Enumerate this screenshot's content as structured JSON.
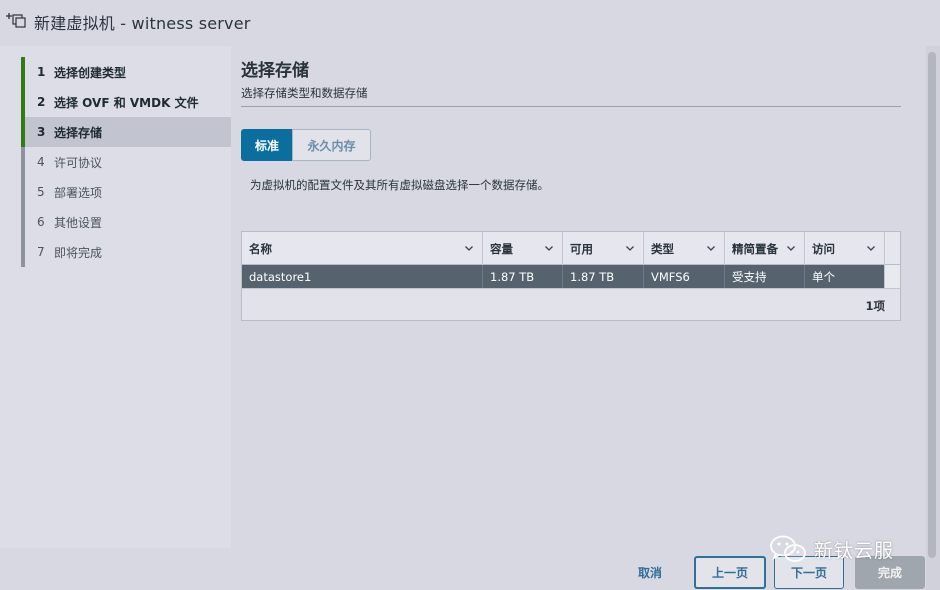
{
  "window": {
    "title": "新建虚拟机 - witness server",
    "icon": "new-vm-icon"
  },
  "sidebar": {
    "steps": [
      {
        "num": "1",
        "label": "选择创建类型",
        "state": "done"
      },
      {
        "num": "2",
        "label": "选择 OVF 和 VMDK 文件",
        "state": "done"
      },
      {
        "num": "3",
        "label": "选择存储",
        "state": "current"
      },
      {
        "num": "4",
        "label": "许可协议",
        "state": "pending"
      },
      {
        "num": "5",
        "label": "部署选项",
        "state": "pending"
      },
      {
        "num": "6",
        "label": "其他设置",
        "state": "pending"
      },
      {
        "num": "7",
        "label": "即将完成",
        "state": "pending"
      }
    ],
    "done_color": "#2e7d14",
    "pending_color": "#8f939b"
  },
  "main": {
    "title": "选择存储",
    "subtitle": "选择存储类型和数据存储",
    "tabs": [
      {
        "label": "标准",
        "active": true
      },
      {
        "label": "永久内存",
        "active": false
      }
    ],
    "description": "为虚拟机的配置文件及其所有虚拟磁盘选择一个数据存储。"
  },
  "grid": {
    "columns": [
      "名称",
      "容量",
      "可用",
      "类型",
      "精简置备",
      "访问"
    ],
    "rows": [
      [
        "datastore1",
        "1.87 TB",
        "1.87 TB",
        "VMFS6",
        "受支持",
        "单个"
      ]
    ],
    "count": "1项"
  },
  "footer": {
    "cancel": "取消",
    "back": "上一页",
    "next": "下一页",
    "finish": "完成"
  },
  "watermark": {
    "text": "新钛云服",
    "icon": "wechat-icon"
  },
  "colors": {
    "accent": "#0a6e9e",
    "selected_row": "#56636f",
    "button_text": "#2f6f98"
  }
}
